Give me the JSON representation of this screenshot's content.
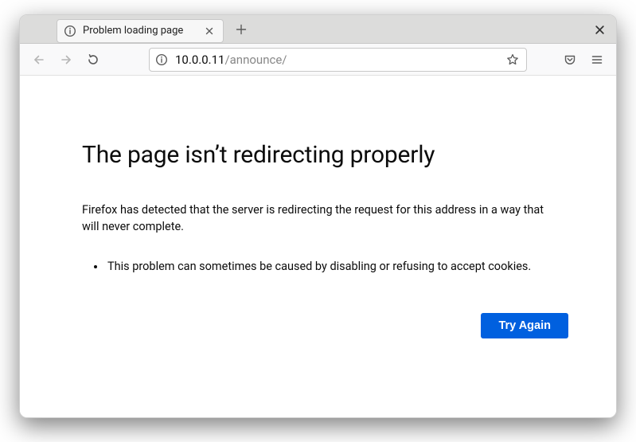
{
  "tab": {
    "title": "Problem loading page"
  },
  "url": {
    "host": "10.0.0.11",
    "path": "/announce/"
  },
  "error": {
    "title": "The page isn’t redirecting properly",
    "description": "Firefox has detected that the server is redirecting the request for this address in a way that will never complete.",
    "bullet": "This problem can sometimes be caused by disabling or refusing to accept cookies.",
    "try_again_label": "Try Again"
  }
}
